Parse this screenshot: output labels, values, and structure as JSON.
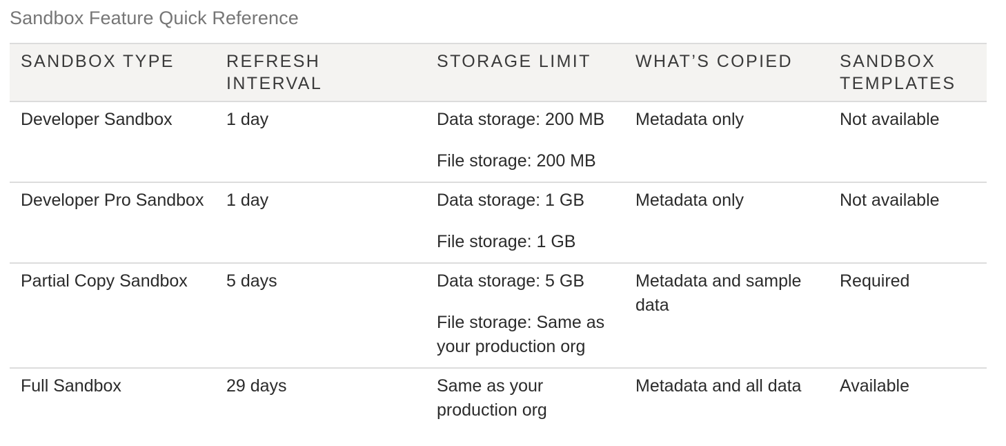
{
  "caption": "Sandbox Feature Quick Reference",
  "columns": [
    "SANDBOX TYPE",
    "REFRESH INTERVAL",
    "STORAGE LIMIT",
    "WHAT’S COPIED",
    "SANDBOX TEMPLATES"
  ],
  "rows": [
    {
      "type": "Developer Sandbox",
      "refresh": "1 day",
      "storage": [
        "Data storage: 200 MB",
        "File storage: 200 MB"
      ],
      "copied": "Metadata only",
      "templates": "Not available"
    },
    {
      "type": "Developer Pro Sandbox",
      "refresh": "1 day",
      "storage": [
        "Data storage: 1 GB",
        "File storage: 1 GB"
      ],
      "copied": "Metadata only",
      "templates": "Not available"
    },
    {
      "type": "Partial Copy Sandbox",
      "refresh": "5 days",
      "storage": [
        "Data storage: 5 GB",
        "File storage: Same as your production org"
      ],
      "copied": "Metadata and sample data",
      "templates": "Required"
    },
    {
      "type": "Full Sandbox",
      "refresh": "29 days",
      "storage": [
        "Same as your production org"
      ],
      "copied": "Metadata and all data",
      "templates": "Available"
    }
  ]
}
